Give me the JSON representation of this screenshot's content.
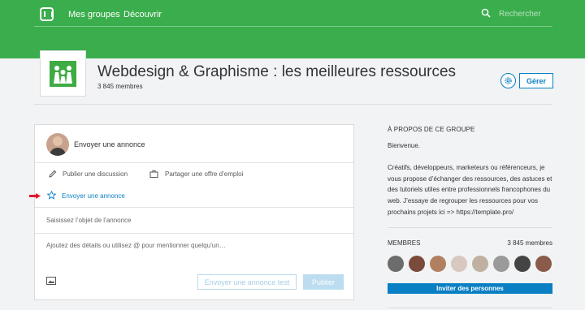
{
  "topbar": {
    "nav": [
      "Mes groupes",
      "Découvrir"
    ],
    "search_placeholder": "Rechercher"
  },
  "group": {
    "title": "Webdesign & Graphisme : les meilleures ressources",
    "member_count": "3 845 membres",
    "manage_label": "Gérer"
  },
  "composer": {
    "heading": "Envoyer une annonce",
    "options": {
      "discussion": "Publier une discussion",
      "job": "Partager une offre d’emploi",
      "announcement": "Envoyer une annonce"
    },
    "subject_placeholder": "Saisissez l’objet de l’annonce",
    "details_placeholder": "Ajoutez des détails ou utilisez @ pour mentionner quelqu’un…",
    "test_button": "Envoyer une annonce test",
    "publish_button": "Publier"
  },
  "sidebar": {
    "about_title": "À PROPOS DE CE GROUPE",
    "about_text": [
      "Bienvenue.",
      "Créatifs, développeurs, marketeurs ou référenceurs, je vous propose d’échanger des ressources, des astuces et des tutoriels utiles entre professionnels francophones du web. J’essaye de regrouper les ressources pour vos prochains projets ici => https://template.pro/"
    ],
    "members_title": "MEMBRES",
    "members_count": "3 845 membres",
    "invite_button": "Inviter des personnes",
    "member_avatar_colors": [
      "#6c6c6c",
      "#7a4a3a",
      "#b08060",
      "#d8c8c0",
      "#c0b0a0",
      "#9a9a9a",
      "#444444",
      "#8a5a4a"
    ]
  },
  "colors": {
    "header_green": "#3aad4c",
    "link_blue": "#0a7fc4",
    "arrow_red": "#e0182d"
  }
}
